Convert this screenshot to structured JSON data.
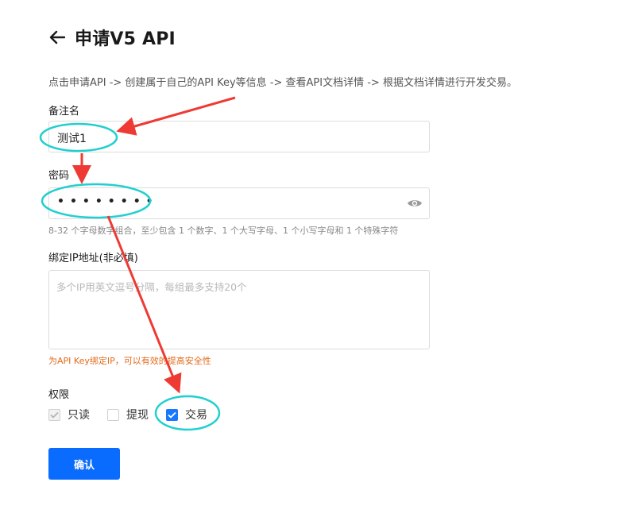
{
  "header": {
    "title": "申请V5 API"
  },
  "intro": "点击申请API -> 创建属于自己的API Key等信息 -> 查看API文档详情 -> 根据文档详情进行开发交易。",
  "note_field": {
    "label": "备注名",
    "value": "测试1"
  },
  "password_field": {
    "label": "密码",
    "value": "••••••••",
    "hint": "8-32 个字母数字组合，至少包含 1 个数字、1 个大写字母、1 个小写字母和 1 个特殊字符"
  },
  "ip_field": {
    "label": "绑定IP地址(非必填)",
    "placeholder": "多个IP用英文逗号分隔，每组最多支持20个",
    "hint": "为API Key绑定IP，可以有效的提高安全性"
  },
  "permissions": {
    "label": "权限",
    "options": [
      {
        "label": "只读",
        "checked": true,
        "disabled": true
      },
      {
        "label": "提现",
        "checked": false,
        "disabled": false
      },
      {
        "label": "交易",
        "checked": true,
        "disabled": false
      }
    ]
  },
  "confirm_label": "确认",
  "colors": {
    "primary": "#0a6cff",
    "annotation_arrow": "#ee3a33",
    "annotation_circle": "#22cfcf",
    "hint_orange": "#e36a1a"
  }
}
